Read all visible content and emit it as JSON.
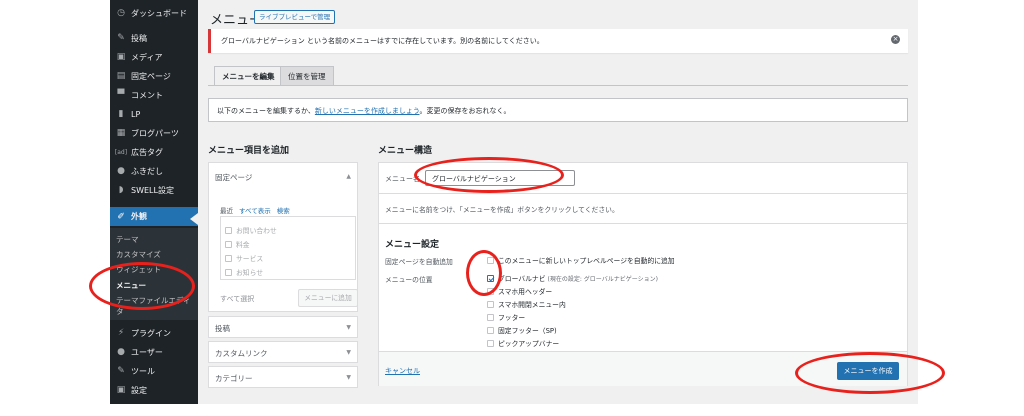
{
  "sidebar": {
    "items": [
      {
        "label": "ダッシュボード",
        "icon": "dashboard-icon",
        "glyph": "◷"
      },
      {
        "label": "投稿",
        "icon": "pin-icon",
        "glyph": "✎"
      },
      {
        "label": "メディア",
        "icon": "media-icon",
        "glyph": "▣"
      },
      {
        "label": "固定ページ",
        "icon": "page-icon",
        "glyph": "▤"
      },
      {
        "label": "コメント",
        "icon": "comment-icon",
        "glyph": "▀"
      },
      {
        "label": "LP",
        "icon": "document-icon",
        "glyph": "▮"
      },
      {
        "label": "ブログパーツ",
        "icon": "grid-icon",
        "glyph": "▦"
      },
      {
        "label": "広告タグ",
        "icon": "ad-icon",
        "glyph": "[ad]"
      },
      {
        "label": "ふきだし",
        "icon": "bubble-icon",
        "glyph": "●"
      },
      {
        "label": "SWELL設定",
        "icon": "swell-icon",
        "glyph": "◗"
      },
      {
        "label": "外観",
        "icon": "brush-icon",
        "glyph": "✐"
      },
      {
        "label": "プラグイン",
        "icon": "plugin-icon",
        "glyph": "⚡"
      },
      {
        "label": "ユーザー",
        "icon": "user-icon",
        "glyph": "●"
      },
      {
        "label": "ツール",
        "icon": "wrench-icon",
        "glyph": "✎"
      },
      {
        "label": "設定",
        "icon": "settings-icon",
        "glyph": "▣"
      }
    ],
    "submenu": [
      "テーマ",
      "カスタマイズ",
      "ウィジェット",
      "メニュー",
      "テーマファイルエディ",
      "タ"
    ]
  },
  "header": {
    "title": "メニュー",
    "preview_button": "ライブプレビューで管理"
  },
  "notice": {
    "text": "グローバルナビゲーション という名前のメニューはすでに存在しています。別の名前にしてください。"
  },
  "tabs": [
    "メニューを編集",
    "位置を管理"
  ],
  "info": {
    "before": "以下のメニューを編集するか、",
    "link": "新しいメニューを作成しましょう",
    "after": "。変更の保存をお忘れなく。"
  },
  "add_items": {
    "title": "メニュー項目を追加",
    "fixed_pages": "固定ページ",
    "subtabs": [
      "最近",
      "すべて表示",
      "検索"
    ],
    "pages": [
      "お問い合わせ",
      "料金",
      "サービス",
      "お知らせ"
    ],
    "select_all": "すべて選択",
    "add_button": "メニューに追加",
    "sections": [
      "投稿",
      "カスタムリンク",
      "カテゴリー"
    ]
  },
  "structure": {
    "title": "メニュー構造",
    "name_label": "メニュー名",
    "name_value": "グローバルナビゲーション",
    "hint": "メニューに名前をつけ、「メニューを作成」ボタンをクリックしてください。",
    "settings_title": "メニュー設定",
    "auto_add_label": "固定ページを自動追加",
    "auto_add_text": "このメニューに新しいトップレベルページを自動的に追加",
    "location_label": "メニューの位置",
    "locations": [
      {
        "label": "グローバルナビ",
        "note": "(現在の設定: グローバルナビゲーション)",
        "checked": true
      },
      {
        "label": "スマホ用ヘッダー",
        "note": "",
        "checked": false
      },
      {
        "label": "スマホ開閉メニュー内",
        "note": "",
        "checked": false
      },
      {
        "label": "フッター",
        "note": "",
        "checked": false
      },
      {
        "label": "固定フッター（SP)",
        "note": "",
        "checked": false
      },
      {
        "label": "ピックアップバナー",
        "note": "",
        "checked": false
      }
    ],
    "cancel": "キャンセル",
    "create_button": "メニューを作成"
  },
  "colors": {
    "admin_bar": "#1d2327",
    "accent": "#2271b1",
    "error": "#d63638",
    "annotation": "#e8211c"
  }
}
